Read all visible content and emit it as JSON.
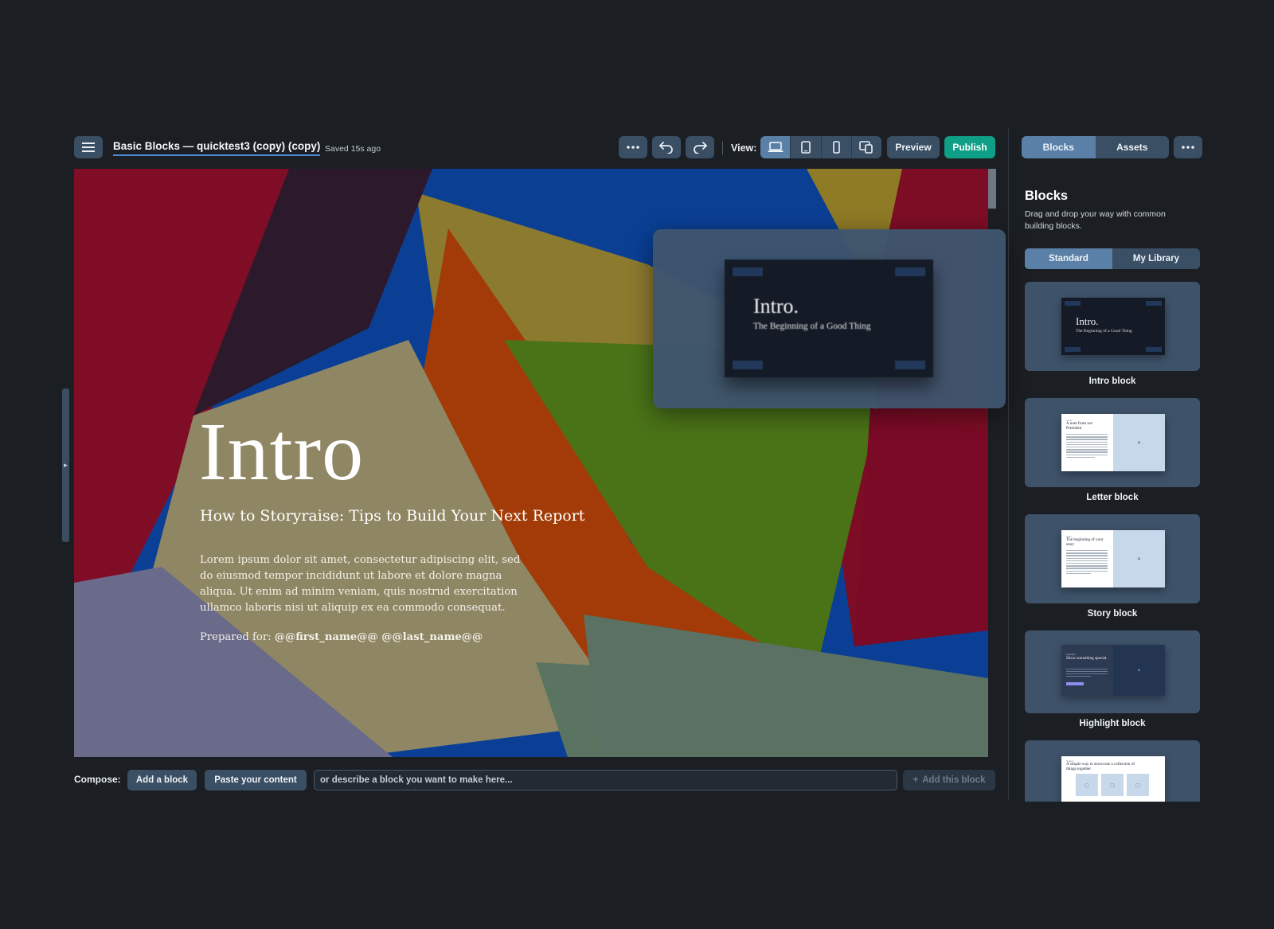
{
  "header": {
    "menu_icon": "hamburger-menu-icon",
    "doc_title": "Basic Blocks — quicktest3 (copy) (copy)",
    "saved_status": "Saved 15s ago",
    "more_icon": "ellipsis-icon",
    "undo_icon": "undo-icon",
    "redo_icon": "redo-icon",
    "view_label": "View:",
    "view_modes": [
      "desktop",
      "tablet",
      "mobile",
      "multi-device"
    ],
    "active_view": "desktop",
    "preview_label": "Preview",
    "publish_label": "Publish"
  },
  "hero": {
    "title": "Intro",
    "subtitle": "How to Storyraise: Tips to Build Your Next Report",
    "body": "Lorem ipsum dolor sit amet, consectetur adipiscing elit, sed do eiusmod tempor incididunt ut labore et dolore magna aliqua. Ut enim ad minim veniam, quis nostrud exercitation ullamco laboris nisi ut aliquip ex ea commodo consequat.",
    "prepared_label": "Prepared for:",
    "prepared_value": "@@first_name@@ @@last_name@@"
  },
  "drag_ghost": {
    "title": "Intro.",
    "subtitle": "The Beginning of a Good Thing"
  },
  "compose": {
    "label": "Compose:",
    "add_block_label": "Add a block",
    "paste_label": "Paste your content",
    "input_placeholder": "or describe a block you want to make here...",
    "add_this_label": "Add this block"
  },
  "panel": {
    "tabs": [
      "Blocks",
      "Assets"
    ],
    "active_tab": "Blocks",
    "title": "Blocks",
    "description": "Drag and drop your way with common building blocks.",
    "library_tabs": [
      "Standard",
      "My Library"
    ],
    "active_library_tab": "Standard",
    "blocks": [
      {
        "label": "Intro block",
        "thumb_title": "Intro.",
        "thumb_subtitle": "The Beginning of a Good Thing"
      },
      {
        "label": "Letter block",
        "thumb_kicker": "Letter",
        "thumb_heading": "A note from our President"
      },
      {
        "label": "Story block",
        "thumb_kicker": "Story",
        "thumb_heading": "The beginning of your story"
      },
      {
        "label": "Highlight block",
        "thumb_kicker": "Highlight",
        "thumb_heading": "Show something special."
      },
      {
        "label": "",
        "thumb_kicker": "Gallery",
        "thumb_heading": "A simple way to showcase a collection of things together."
      }
    ]
  },
  "colors": {
    "accent": "#5a80a8",
    "publish": "#0f9f86",
    "button": "#3a4e64",
    "background": "#1b1e23"
  }
}
